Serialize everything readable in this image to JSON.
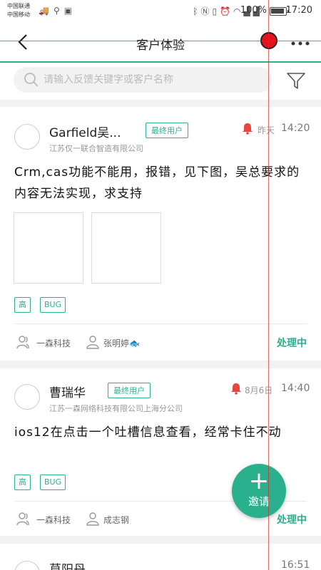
{
  "status_bar": {
    "carrier_1": "中国联通",
    "carrier_2": "中国移动",
    "battery_pct": "100%",
    "battery_level": 1.0,
    "time": "17:20"
  },
  "header": {
    "title": "客户体验"
  },
  "search": {
    "placeholder": "请输入反馈关键字或客户名称"
  },
  "colors": {
    "accent": "#2bb08e",
    "alert": "#e8453c"
  },
  "feedbacks": [
    {
      "name": "Garfield吴...",
      "role": "最终用户",
      "company": "江苏仅一联合智造有限公司",
      "date": "昨天",
      "time": "14:20",
      "content": "Crm,cas功能不能用，报错，见下图，吴总要求的内容无法实现，求支持",
      "tags": [
        "高",
        "BUG"
      ],
      "team": "一森科技",
      "assignee": "张明婷🐟",
      "status": "处理中"
    },
    {
      "name": "曹瑞华",
      "role": "最终用户",
      "company": "江苏一森网络科技有限公司上海分公司",
      "date": "8月6日",
      "time": "14:40",
      "content": "ios12在点击一个吐槽信息查看，经常卡住不动",
      "tags": [
        "高",
        "BUG"
      ],
      "team": "一森科技",
      "assignee": "成志钢",
      "status": "处理中"
    },
    {
      "name": "莫阳丹",
      "time": "16:51"
    }
  ],
  "fab": {
    "plus": "+",
    "label": "邀请"
  }
}
